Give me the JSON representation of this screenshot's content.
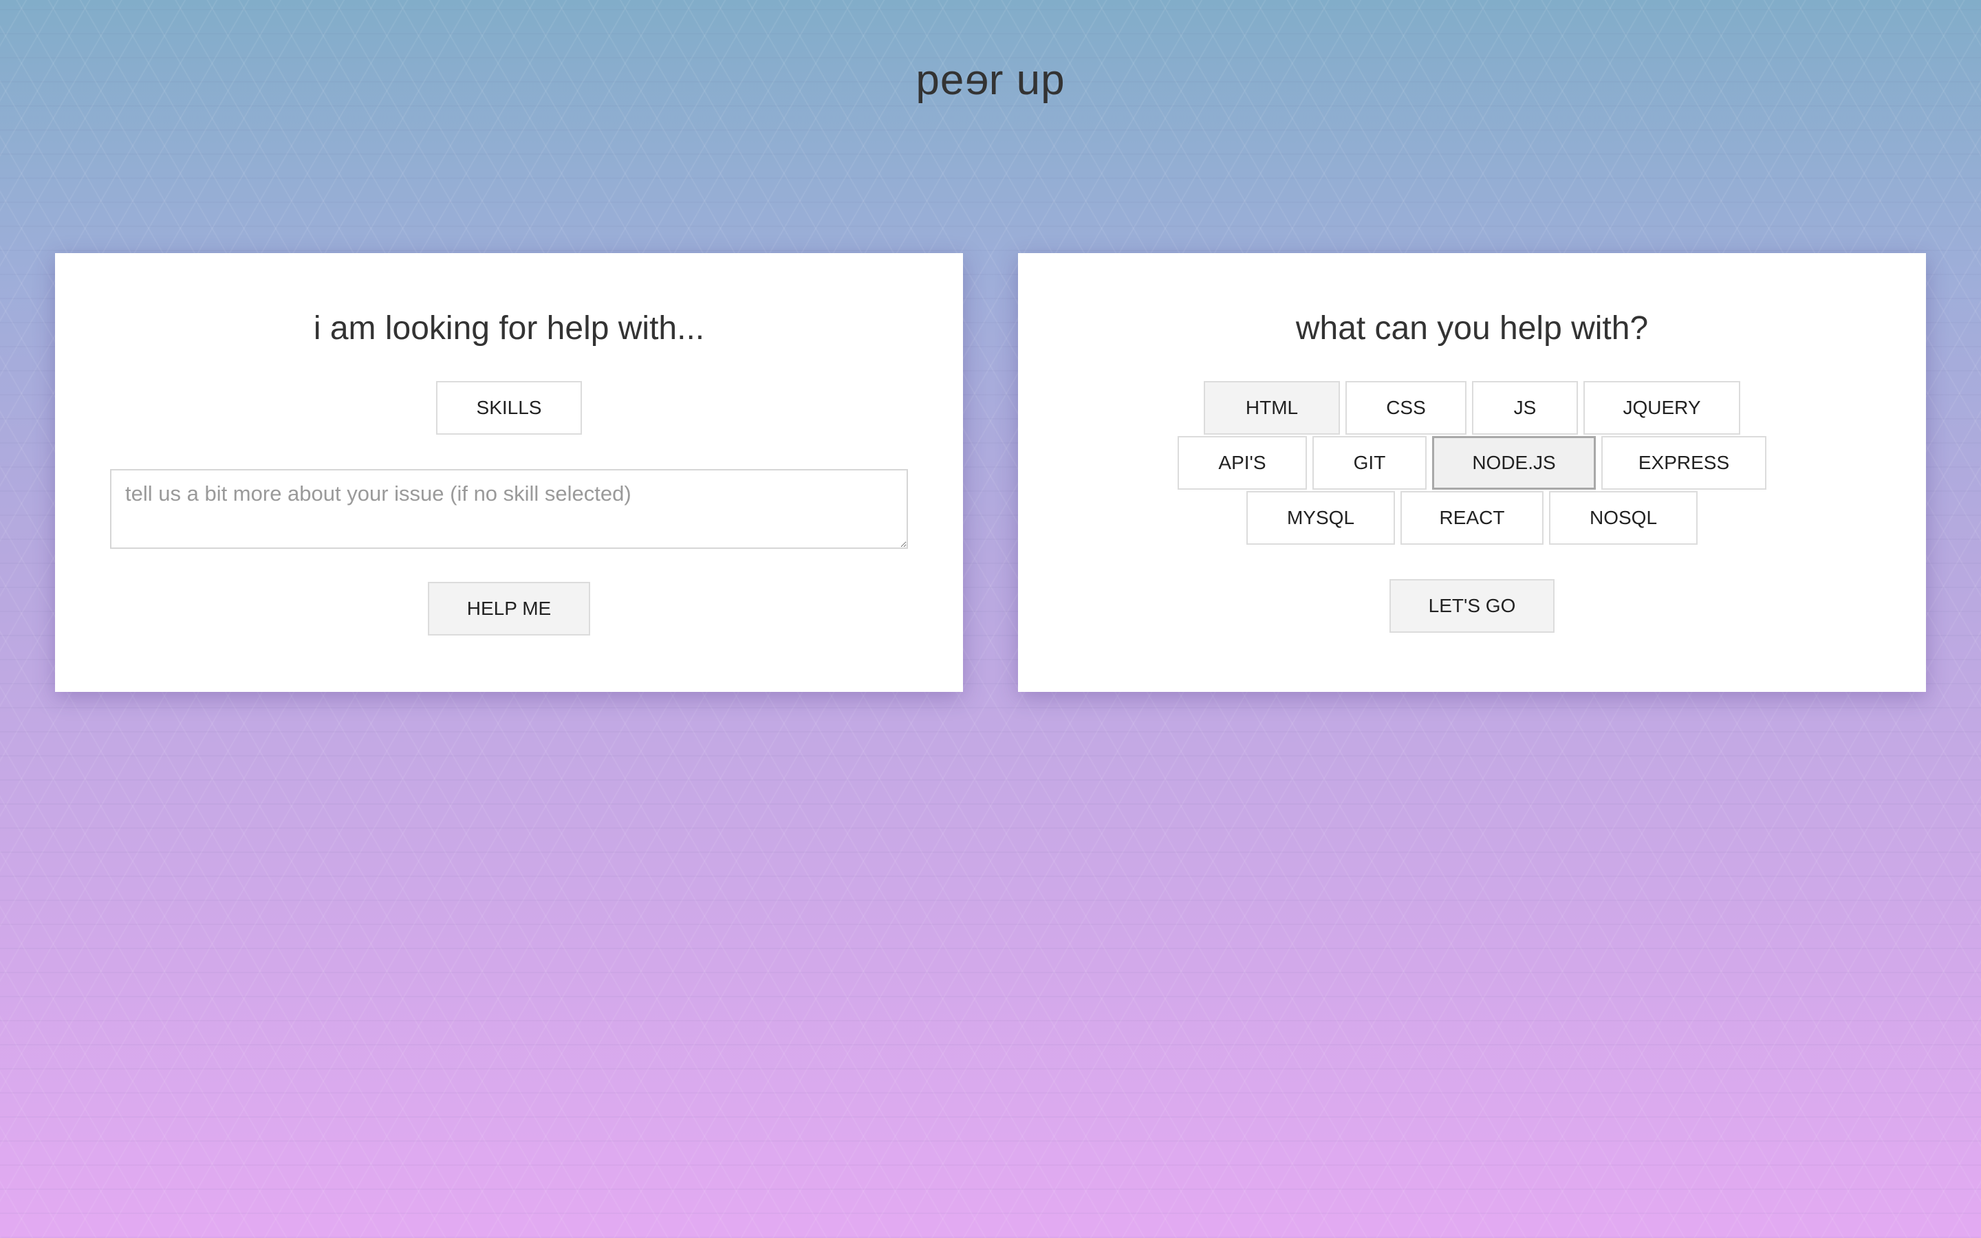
{
  "header": {
    "title_part1": "pe",
    "title_flipped": "e",
    "title_part2": "r up"
  },
  "seeker_card": {
    "heading": "i am looking for help with...",
    "skills_button": "SKILLS",
    "issue_placeholder": "tell us a bit more about your issue (if no skill selected)",
    "issue_value": "",
    "submit_button": "HELP ME"
  },
  "helper_card": {
    "heading": "what can you help with?",
    "skills": [
      {
        "label": "HTML",
        "state": "hover"
      },
      {
        "label": "CSS",
        "state": "default"
      },
      {
        "label": "JS",
        "state": "default"
      },
      {
        "label": "JQUERY",
        "state": "default"
      },
      {
        "label": "API'S",
        "state": "default"
      },
      {
        "label": "GIT",
        "state": "default"
      },
      {
        "label": "NODE.JS",
        "state": "selected"
      },
      {
        "label": "EXPRESS",
        "state": "default"
      },
      {
        "label": "MYSQL",
        "state": "default"
      },
      {
        "label": "REACT",
        "state": "default"
      },
      {
        "label": "NOSQL",
        "state": "default"
      }
    ],
    "submit_button": "LET'S GO"
  },
  "colors": {
    "gradient_top": "#82adc9",
    "gradient_bottom": "#e3aaf2",
    "card_background": "#ffffff",
    "text": "#333333",
    "button_border": "#dcdcdc",
    "selected_border": "#a8a8a8"
  }
}
